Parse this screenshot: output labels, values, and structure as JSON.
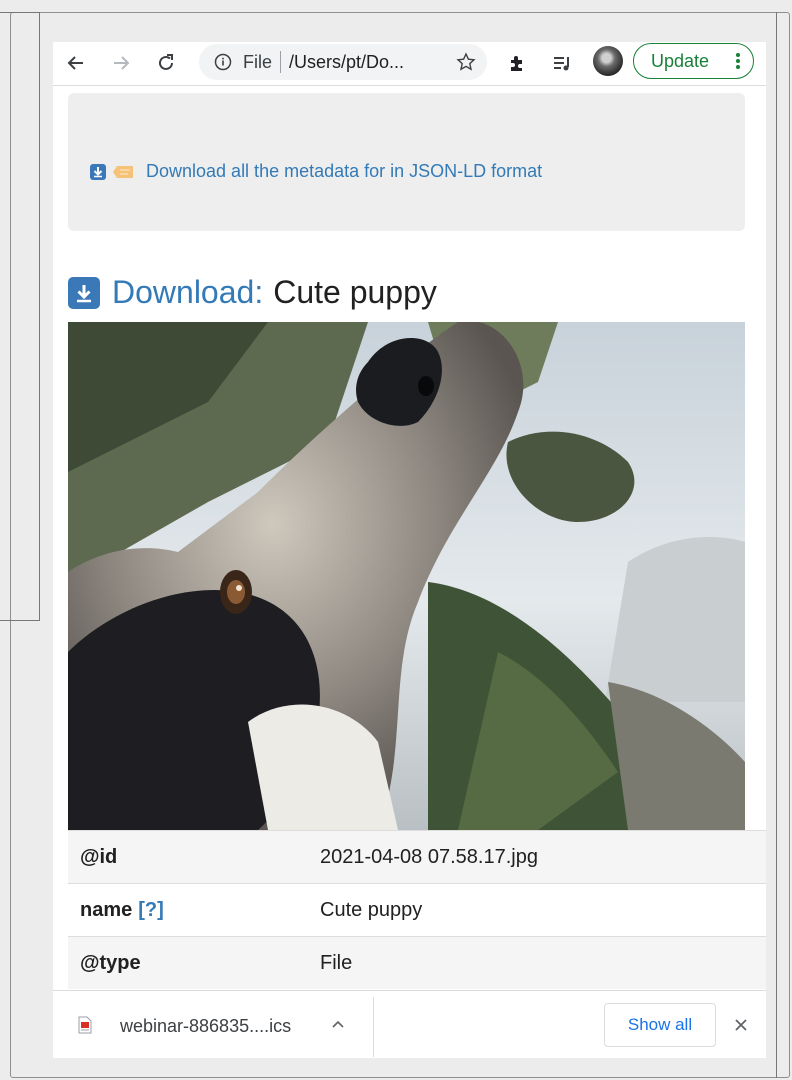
{
  "browser": {
    "omnibox": {
      "scheme": "File",
      "path": "/Users/pt/Do..."
    },
    "update_label": "Update"
  },
  "metadata_panel": {
    "link_text": "Download all the metadata for in JSON-LD format"
  },
  "heading": {
    "download_word": "Download:",
    "title": "Cute puppy"
  },
  "properties": [
    {
      "key": "@id",
      "help": "",
      "value": "2021-04-08 07.58.17.jpg"
    },
    {
      "key": "name",
      "help": "[?]",
      "value": "Cute puppy"
    },
    {
      "key": "@type",
      "help": "",
      "value": "File"
    }
  ],
  "download_shelf": {
    "filename": "webinar-886835....ics",
    "show_all": "Show all"
  },
  "colors": {
    "link": "#337ab7",
    "update_green": "#188038",
    "show_all_blue": "#1a73e8",
    "download_icon": "#3b78b7"
  }
}
